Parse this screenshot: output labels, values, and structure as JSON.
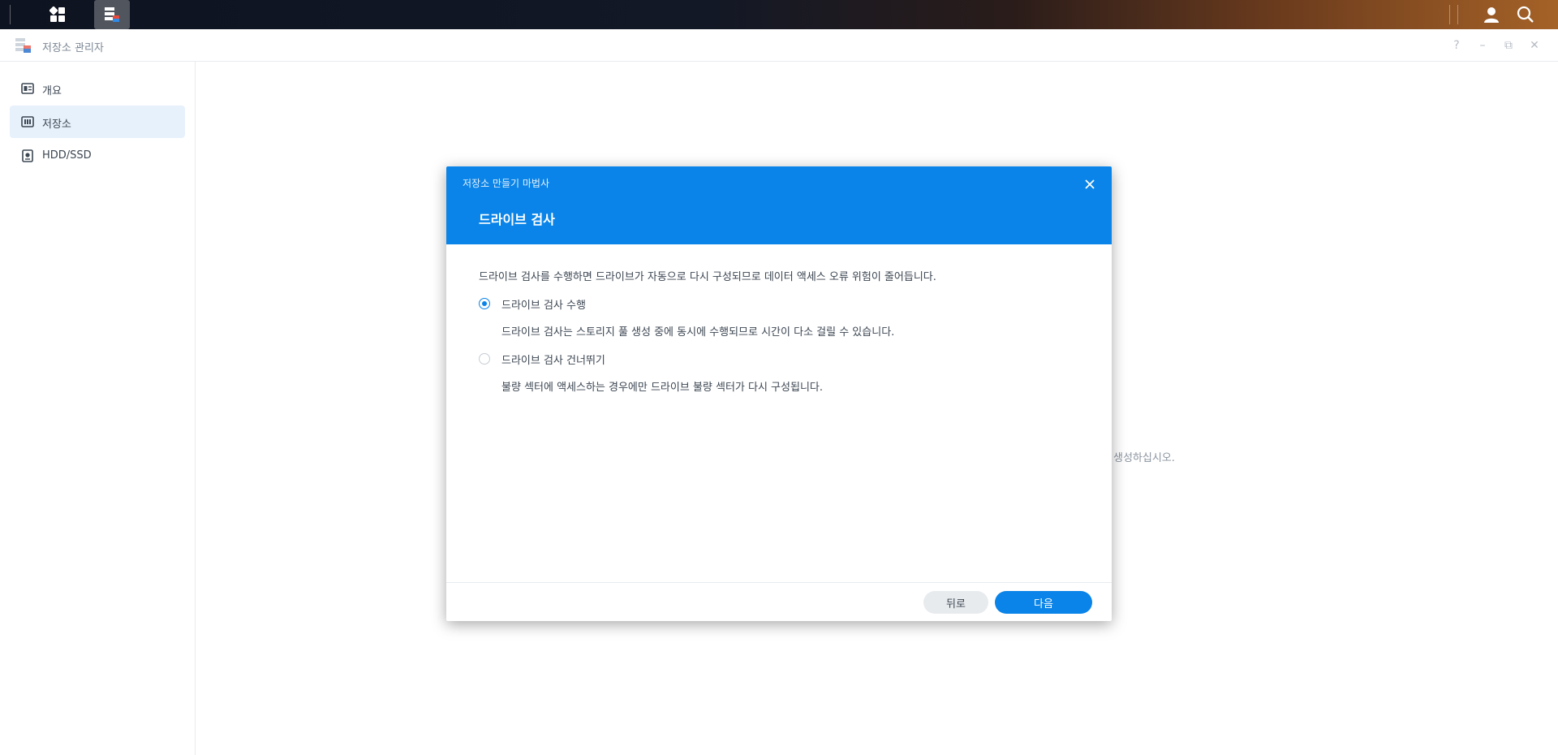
{
  "window": {
    "title": "저장소 관리자",
    "controls": {
      "help": "?",
      "minimize": "–",
      "restore": "⧉",
      "close": "✕"
    }
  },
  "sidebar": {
    "items": [
      {
        "label": "개요",
        "icon": "overview-icon",
        "active": false
      },
      {
        "label": "저장소",
        "icon": "storage-icon",
        "active": true
      },
      {
        "label": "HDD/SSD",
        "icon": "hdd-icon",
        "active": false
      }
    ]
  },
  "background": {
    "partial_text": "생성하십시오."
  },
  "dialog": {
    "caption": "저장소 만들기 마법사",
    "title": "드라이브 검사",
    "description": "드라이브 검사를 수행하면 드라이브가 자동으로 다시 구성되므로 데이터 액세스 오류 위험이 줄어듭니다.",
    "options": [
      {
        "label": "드라이브 검사 수행",
        "description": "드라이브 검사는 스토리지 풀 생성 중에 동시에 수행되므로 시간이 다소 걸릴 수 있습니다.",
        "checked": true
      },
      {
        "label": "드라이브 검사 건너뛰기",
        "description": "불량 섹터에 액세스하는 경우에만 드라이브 불량 섹터가 다시 구성됩니다.",
        "checked": false
      }
    ],
    "buttons": {
      "back": "뒤로",
      "next": "다음"
    }
  },
  "colors": {
    "accent": "#0a84e8",
    "sidebar_active_bg": "#e7f1fc",
    "text": "#3c4652"
  }
}
